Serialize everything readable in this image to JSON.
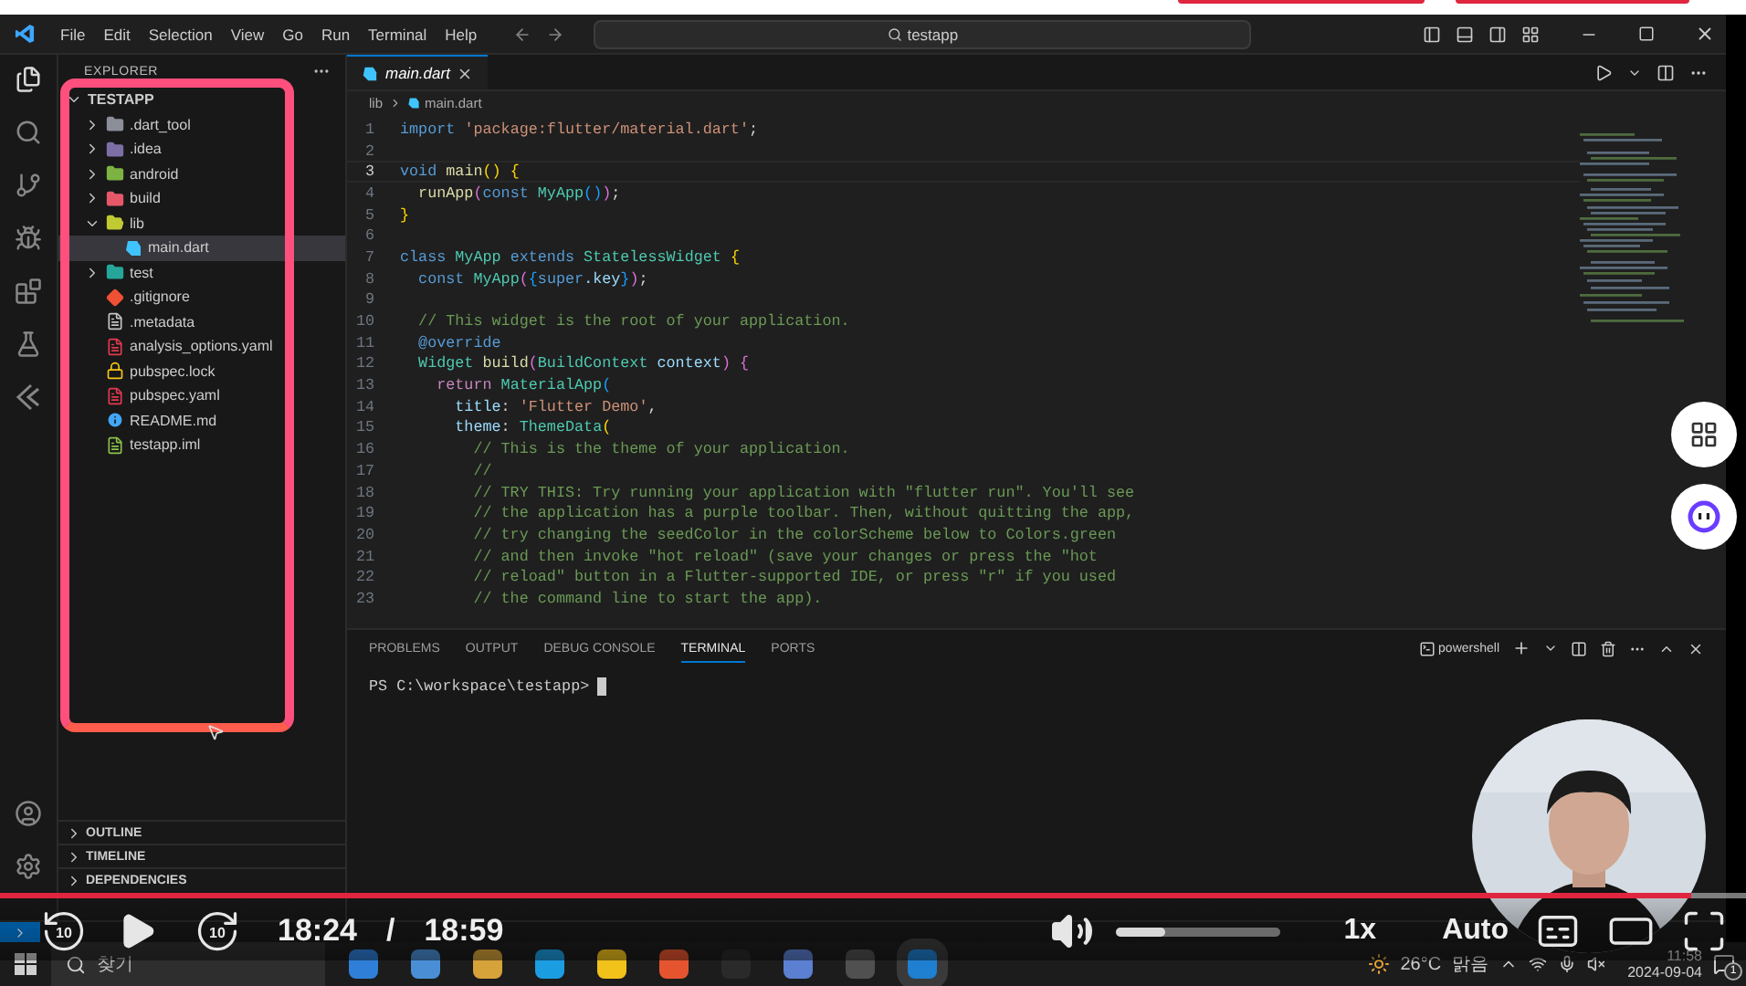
{
  "window": {
    "title": "testapp"
  },
  "menu": [
    "File",
    "Edit",
    "Selection",
    "View",
    "Go",
    "Run",
    "Terminal",
    "Help"
  ],
  "explorer": {
    "title": "EXPLORER",
    "root": {
      "label": "TESTAPP",
      "expanded": true,
      "children": [
        {
          "label": ".dart_tool",
          "kind": "folder",
          "color": "#8a8f98",
          "expanded": false,
          "selected": false
        },
        {
          "label": ".idea",
          "kind": "folder",
          "color": "#7d6fa6",
          "expanded": false,
          "selected": false
        },
        {
          "label": "android",
          "kind": "folder",
          "color": "#7cb342",
          "expanded": false,
          "selected": false
        },
        {
          "label": "build",
          "kind": "folder",
          "color": "#e5586a",
          "expanded": false,
          "selected": false
        },
        {
          "label": "lib",
          "kind": "folder",
          "color": "#c0ca33",
          "expanded": true,
          "selected": false,
          "children": [
            {
              "label": "main.dart",
              "kind": "dart",
              "color": "#40c4ff",
              "selected": true
            }
          ]
        },
        {
          "label": "test",
          "kind": "folder",
          "color": "#26a69a",
          "expanded": false,
          "selected": false
        },
        {
          "label": ".gitignore",
          "kind": "git",
          "color": "#f05033",
          "selected": false
        },
        {
          "label": ".metadata",
          "kind": "doc",
          "color": "#c5c5c5",
          "selected": false
        },
        {
          "label": "analysis_options.yaml",
          "kind": "doc",
          "color": "#e53950",
          "selected": false
        },
        {
          "label": "pubspec.lock",
          "kind": "lock",
          "color": "#f5c518",
          "selected": false
        },
        {
          "label": "pubspec.yaml",
          "kind": "doc",
          "color": "#e53950",
          "selected": false
        },
        {
          "label": "README.md",
          "kind": "info",
          "color": "#42a5f5",
          "selected": false
        },
        {
          "label": "testapp.iml",
          "kind": "doc",
          "color": "#8bc34a",
          "selected": false
        }
      ]
    },
    "sections": [
      {
        "label": "OUTLINE",
        "expanded": false
      },
      {
        "label": "TIMELINE",
        "expanded": false
      },
      {
        "label": "DEPENDENCIES",
        "expanded": false
      }
    ]
  },
  "editor": {
    "tabs": [
      {
        "label": "main.dart",
        "selected": true
      }
    ],
    "breadcrumb": [
      "lib",
      "main.dart"
    ],
    "lines": [
      {
        "number": "1",
        "current": false,
        "tokens": [
          {
            "text": "import ",
            "kind": "keyword"
          },
          {
            "text": "'package:flutter/material.dart'",
            "kind": "string"
          },
          {
            "text": ";",
            "kind": "plain"
          }
        ]
      },
      {
        "number": "2",
        "current": false
      },
      {
        "number": "3",
        "current": true,
        "tokens": [
          {
            "text": "void ",
            "kind": "keyword"
          },
          {
            "text": "main",
            "kind": "function"
          },
          {
            "text": "() ",
            "kind": "bracket1"
          },
          {
            "text": "{",
            "kind": "bracket1"
          }
        ]
      },
      {
        "number": "4",
        "current": false,
        "tokens": [
          {
            "text": "  runApp",
            "kind": "function"
          },
          {
            "text": "(",
            "kind": "bracket2"
          },
          {
            "text": "const ",
            "kind": "keyword"
          },
          {
            "text": "MyApp",
            "kind": "type"
          },
          {
            "text": "()",
            "kind": "bracket3"
          },
          {
            "text": ")",
            "kind": "bracket2"
          },
          {
            "text": ";",
            "kind": "plain"
          }
        ]
      },
      {
        "number": "5",
        "current": false,
        "tokens": [
          {
            "text": "}",
            "kind": "bracket1"
          }
        ]
      },
      {
        "number": "6",
        "current": false
      },
      {
        "number": "7",
        "current": false,
        "tokens": [
          {
            "text": "class ",
            "kind": "keyword"
          },
          {
            "text": "MyApp ",
            "kind": "type"
          },
          {
            "text": "extends ",
            "kind": "keyword"
          },
          {
            "text": "StatelessWidget ",
            "kind": "type"
          },
          {
            "text": "{",
            "kind": "bracket1"
          }
        ]
      },
      {
        "number": "8",
        "current": false,
        "tokens": [
          {
            "text": "  const ",
            "kind": "keyword"
          },
          {
            "text": "MyApp",
            "kind": "type"
          },
          {
            "text": "(",
            "kind": "bracket2"
          },
          {
            "text": "{",
            "kind": "bracket3"
          },
          {
            "text": "super",
            "kind": "keyword"
          },
          {
            "text": ".key",
            "kind": "property"
          },
          {
            "text": "}",
            "kind": "bracket3"
          },
          {
            "text": ")",
            "kind": "bracket2"
          },
          {
            "text": ";",
            "kind": "plain"
          }
        ]
      },
      {
        "number": "9",
        "current": false
      },
      {
        "number": "10",
        "current": false,
        "tokens": [
          {
            "text": "  // This widget is the root of your application.",
            "kind": "comment"
          }
        ]
      },
      {
        "number": "11",
        "current": false,
        "tokens": [
          {
            "text": "  @override",
            "kind": "keyword"
          }
        ]
      },
      {
        "number": "12",
        "current": false,
        "tokens": [
          {
            "text": "  Widget ",
            "kind": "type"
          },
          {
            "text": "build",
            "kind": "function"
          },
          {
            "text": "(",
            "kind": "bracket2"
          },
          {
            "text": "BuildContext ",
            "kind": "type"
          },
          {
            "text": "context",
            "kind": "property"
          },
          {
            "text": ") ",
            "kind": "bracket2"
          },
          {
            "text": "{",
            "kind": "bracket2"
          }
        ]
      },
      {
        "number": "13",
        "current": false,
        "tokens": [
          {
            "text": "    return ",
            "kind": "control"
          },
          {
            "text": "MaterialApp",
            "kind": "type"
          },
          {
            "text": "(",
            "kind": "bracket3"
          }
        ]
      },
      {
        "number": "14",
        "current": false,
        "tokens": [
          {
            "text": "      title",
            "kind": "property"
          },
          {
            "text": ": ",
            "kind": "plain"
          },
          {
            "text": "'Flutter Demo'",
            "kind": "string"
          },
          {
            "text": ",",
            "kind": "plain"
          }
        ]
      },
      {
        "number": "15",
        "current": false,
        "tokens": [
          {
            "text": "      theme",
            "kind": "property"
          },
          {
            "text": ": ",
            "kind": "plain"
          },
          {
            "text": "ThemeData",
            "kind": "type"
          },
          {
            "text": "(",
            "kind": "bracket1"
          }
        ]
      },
      {
        "number": "16",
        "current": false,
        "tokens": [
          {
            "text": "        // This is the theme of your application.",
            "kind": "comment"
          }
        ]
      },
      {
        "number": "17",
        "current": false,
        "tokens": [
          {
            "text": "        //",
            "kind": "comment"
          }
        ]
      },
      {
        "number": "18",
        "current": false,
        "tokens": [
          {
            "text": "        // TRY THIS: Try running your application with \"flutter run\". You'll see",
            "kind": "comment"
          }
        ]
      },
      {
        "number": "19",
        "current": false,
        "tokens": [
          {
            "text": "        // the application has a purple toolbar. Then, without quitting the app,",
            "kind": "comment"
          }
        ]
      },
      {
        "number": "20",
        "current": false,
        "tokens": [
          {
            "text": "        // try changing the seedColor in the colorScheme below to Colors.green",
            "kind": "comment"
          }
        ]
      },
      {
        "number": "21",
        "current": false,
        "tokens": [
          {
            "text": "        // and then invoke \"hot reload\" (save your changes or press the \"hot",
            "kind": "comment"
          }
        ]
      },
      {
        "number": "22",
        "current": false,
        "tokens": [
          {
            "text": "        // reload\" button in a Flutter-supported IDE, or press \"r\" if you used",
            "kind": "comment"
          }
        ]
      },
      {
        "number": "23",
        "current": false,
        "tokens": [
          {
            "text": "        // the command line to start the app).",
            "kind": "comment"
          }
        ]
      }
    ]
  },
  "panel": {
    "tabs": [
      {
        "label": "PROBLEMS",
        "selected": false
      },
      {
        "label": "OUTPUT",
        "selected": false
      },
      {
        "label": "DEBUG CONSOLE",
        "selected": false
      },
      {
        "label": "TERMINAL",
        "selected": true
      },
      {
        "label": "PORTS",
        "selected": false
      }
    ],
    "shell": "powershell",
    "prompt": "PS C:\\workspace\\testapp>"
  },
  "player": {
    "progress": {
      "level": 0.969
    },
    "playing": false,
    "rewind": "10",
    "forward": "10",
    "current_time": "18:24",
    "separator": "/",
    "duration": "18:59",
    "volume": {
      "level": 0.3
    },
    "speed": "1x",
    "quality": "Auto"
  },
  "taskbar": {
    "search": {
      "placeholder": "찾기"
    },
    "temperature": "26°C",
    "condition": "맑음",
    "time": "11:58",
    "date": "2024-09-04",
    "notifications": "1"
  }
}
